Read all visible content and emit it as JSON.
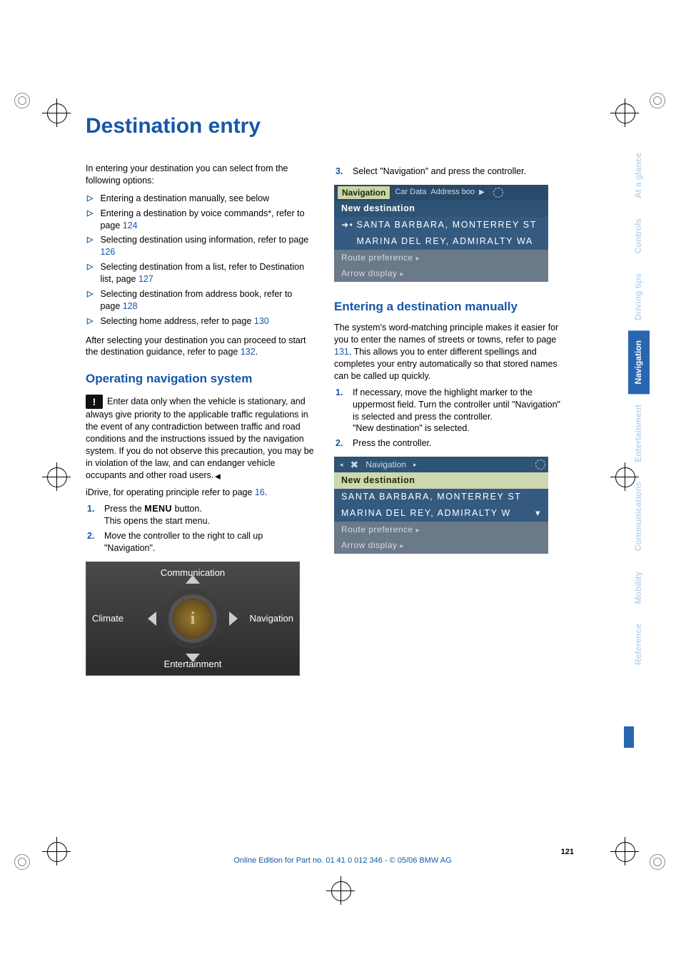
{
  "page": {
    "title": "Destination entry",
    "intro": "In entering your destination you can select from the following options:",
    "bullets": [
      {
        "text": "Entering a destination manually, see below",
        "link": ""
      },
      {
        "text_pre": "Entering a destination by voice commands",
        "star": "*",
        "text_post": ", refer to page ",
        "link": "124"
      },
      {
        "text_pre": "Selecting destination using information, refer to page ",
        "link": "126"
      },
      {
        "text_pre": "Selecting destination from a list, refer to Destination list, page ",
        "link": "127"
      },
      {
        "text_pre": "Selecting destination from address book, refer to page ",
        "link": "128"
      },
      {
        "text_pre": "Selecting home address, refer to page ",
        "link": "130"
      }
    ],
    "after_select": {
      "text_pre": "After selecting your destination you can proceed to start the destination guidance, refer to page ",
      "link": "132",
      "tail": "."
    },
    "section_op": "Operating navigation system",
    "warn_text": "Enter data only when the vehicle is stationary, and always give priority to the applicable traffic regulations in the event of any contradiction between traffic and road conditions and the instructions issued by the navigation system. If you do not observe this precaution, you may be in violation of the law, and can endanger vehicle occupants and other road users.",
    "idrive_note": {
      "pre": "iDrive, for operating principle refer to page ",
      "link": "16",
      "tail": "."
    },
    "op_steps": [
      {
        "n": "1.",
        "text_pre": "Press the ",
        "menu": "MENU",
        "text_post": " button.",
        "line2": "This opens the start menu."
      },
      {
        "n": "2.",
        "text_pre": "Move the controller to the right to call up \"Navigation\"."
      }
    ],
    "idrive_labels": {
      "top": "Communication",
      "bottom": "Entertainment",
      "left": "Climate",
      "right": "Navigation"
    },
    "col2_step3": {
      "n": "3.",
      "text": "Select \"Navigation\" and press the controller."
    },
    "nav_screen1": {
      "tab_selected": "Navigation",
      "tab2": "Car Data",
      "tab3": "Address boo",
      "row_head": "New destination",
      "dest1": "SANTA BARBARA, MONTERREY ST",
      "dest2": "MARINA DEL REY, ADMIRALTY WA",
      "foot1": "Route preference",
      "foot2": "Arrow display"
    },
    "section_manual": "Entering a destination manually",
    "manual_para": {
      "pre": "The system's word-matching principle makes it easier for you to enter the names of streets or towns, refer to page ",
      "link": "131",
      "post": ". This allows you to enter different spellings and completes your entry automatically so that stored names can be called up quickly."
    },
    "manual_steps": [
      {
        "n": "1.",
        "text": "If necessary, move the highlight marker to the uppermost field. Turn the controller until \"Navigation\" is selected and press the controller.",
        "line2": "\"New destination\" is selected."
      },
      {
        "n": "2.",
        "text": "Press the controller."
      }
    ],
    "nav_screen2": {
      "crumb": "Navigation",
      "row_head": "New destination",
      "dest1": "SANTA BARBARA, MONTERREY ST",
      "dest2": "MARINA DEL REY, ADMIRALTY W",
      "foot1": "Route preference",
      "foot2": "Arrow display"
    },
    "footer": {
      "pageno": "121",
      "meta": "Online Edition for Part no. 01 41 0 012 346 - © 05/06 BMW AG"
    }
  },
  "side_tabs": [
    "At a glance",
    "Controls",
    "Driving tips",
    "Navigation",
    "Entertainment",
    "Communications",
    "Mobility",
    "Reference"
  ]
}
